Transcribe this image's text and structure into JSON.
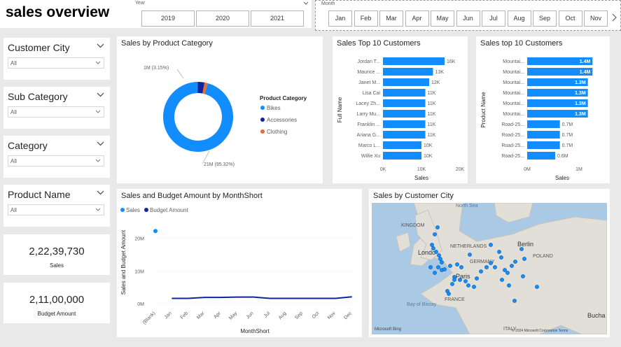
{
  "page": {
    "title": "sales overview"
  },
  "year_slicer": {
    "label": "Year",
    "options": [
      "2019",
      "2020",
      "2021"
    ]
  },
  "month_slicer": {
    "label": "Month",
    "options": [
      "Jan",
      "Feb",
      "Mar",
      "Apr",
      "May",
      "Jun",
      "Jul",
      "Aug",
      "Sep",
      "Oct",
      "Nov"
    ],
    "next_icon": "chevron-right-icon"
  },
  "filters": [
    {
      "label": "Customer City",
      "value": "All"
    },
    {
      "label": "Sub Category",
      "value": "All"
    },
    {
      "label": "Category",
      "value": "All"
    },
    {
      "label": "Product Name",
      "value": "All"
    }
  ],
  "kpis": [
    {
      "value": "2,22,39,730",
      "label": "Sales"
    },
    {
      "value": "2,11,00,000",
      "label": "Budget Amount"
    }
  ],
  "colors": {
    "bikes": "#118dff",
    "accessories": "#12239e",
    "clothing": "#e66c37",
    "budget": "#12239e"
  },
  "chart_data": [
    {
      "type": "pie",
      "title": "Sales by Product Category",
      "legend_title": "Product Category",
      "legend_position": "right",
      "categories": [
        "Bikes",
        "Accessories",
        "Clothing"
      ],
      "values": [
        95.32,
        3.15,
        1.53
      ],
      "data_labels": [
        "21M (95.32%)",
        "1M (3.15%)"
      ]
    },
    {
      "type": "bar",
      "orientation": "horizontal",
      "title": "Sales Top 10 Customers",
      "xlabel": "Sales",
      "ylabel": "Full Name",
      "categories": [
        "Jordan T...",
        "Maurice ...",
        "Janet M...",
        "Lisa Cai",
        "Lacey Zh...",
        "Larry Mu...",
        "Franklin ...",
        "Ariana G...",
        "Marco L...",
        "Willie Xu"
      ],
      "values": [
        16000,
        13000,
        12000,
        11000,
        11000,
        11000,
        11000,
        11000,
        10000,
        10000
      ],
      "data_labels": [
        "16K",
        "13K",
        "12K",
        "11K",
        "11K",
        "11K",
        "11K",
        "11K",
        "10K",
        "10K"
      ],
      "xticks": [
        "0K",
        "10K",
        "20K"
      ],
      "xlim": [
        0,
        20000
      ]
    },
    {
      "type": "bar",
      "orientation": "horizontal",
      "title": "Sales top 10 Customers",
      "xlabel": "Sales",
      "ylabel": "Product Name",
      "categories": [
        "Mountai...",
        "Mountai...",
        "Mountai...",
        "Mountai...",
        "Mountai...",
        "Mountai...",
        "Road-25...",
        "Road-25...",
        "Road-25...",
        "Road-25..."
      ],
      "values": [
        1400000,
        1400000,
        1300000,
        1300000,
        1300000,
        1300000,
        700000,
        700000,
        700000,
        600000
      ],
      "data_labels": [
        "1.4M",
        "1.4M",
        "1.3M",
        "1.3M",
        "1.3M",
        "1.3M",
        "0.7M",
        "0.7M",
        "0.7M",
        "0.6M"
      ],
      "xticks": [
        "0M",
        "1M"
      ],
      "xlim": [
        0,
        1500000
      ]
    },
    {
      "type": "line",
      "title": "Sales and Budget Amount by MonthShort",
      "xlabel": "MonthShort",
      "ylabel": "Sales and Budget Amount",
      "legend_position": "top-left",
      "categories": [
        "(Blank)",
        "Jan",
        "Feb",
        "Mar",
        "Apr",
        "May",
        "Jun",
        "Jul",
        "Aug",
        "Sep",
        "Oct",
        "Nov",
        "Dec"
      ],
      "yticks": [
        "0M",
        "10M",
        "20M"
      ],
      "ylim": [
        0,
        24000000
      ],
      "series": [
        {
          "name": "Sales",
          "values": [
            22239730,
            null,
            null,
            null,
            null,
            null,
            null,
            null,
            null,
            null,
            null,
            null,
            null
          ]
        },
        {
          "name": "Budget Amount",
          "values": [
            null,
            1600000,
            1600000,
            1900000,
            1900000,
            2000000,
            2000000,
            1600000,
            1600000,
            1600000,
            1600000,
            1600000,
            2100000
          ]
        }
      ]
    }
  ],
  "map": {
    "title": "Sales by Customer City",
    "labels": [
      "North Sea",
      "KINGDOM",
      "NETHERLANDS",
      "Berlin",
      "POLAND",
      "Londo",
      "GERMANY",
      "Paris",
      "FRANCE",
      "Bay of Biscay",
      "ITALY",
      "Bucha"
    ],
    "attribution": "Microsoft Bing",
    "copyright": "© 2024 Microsoft Corporation Terms"
  }
}
